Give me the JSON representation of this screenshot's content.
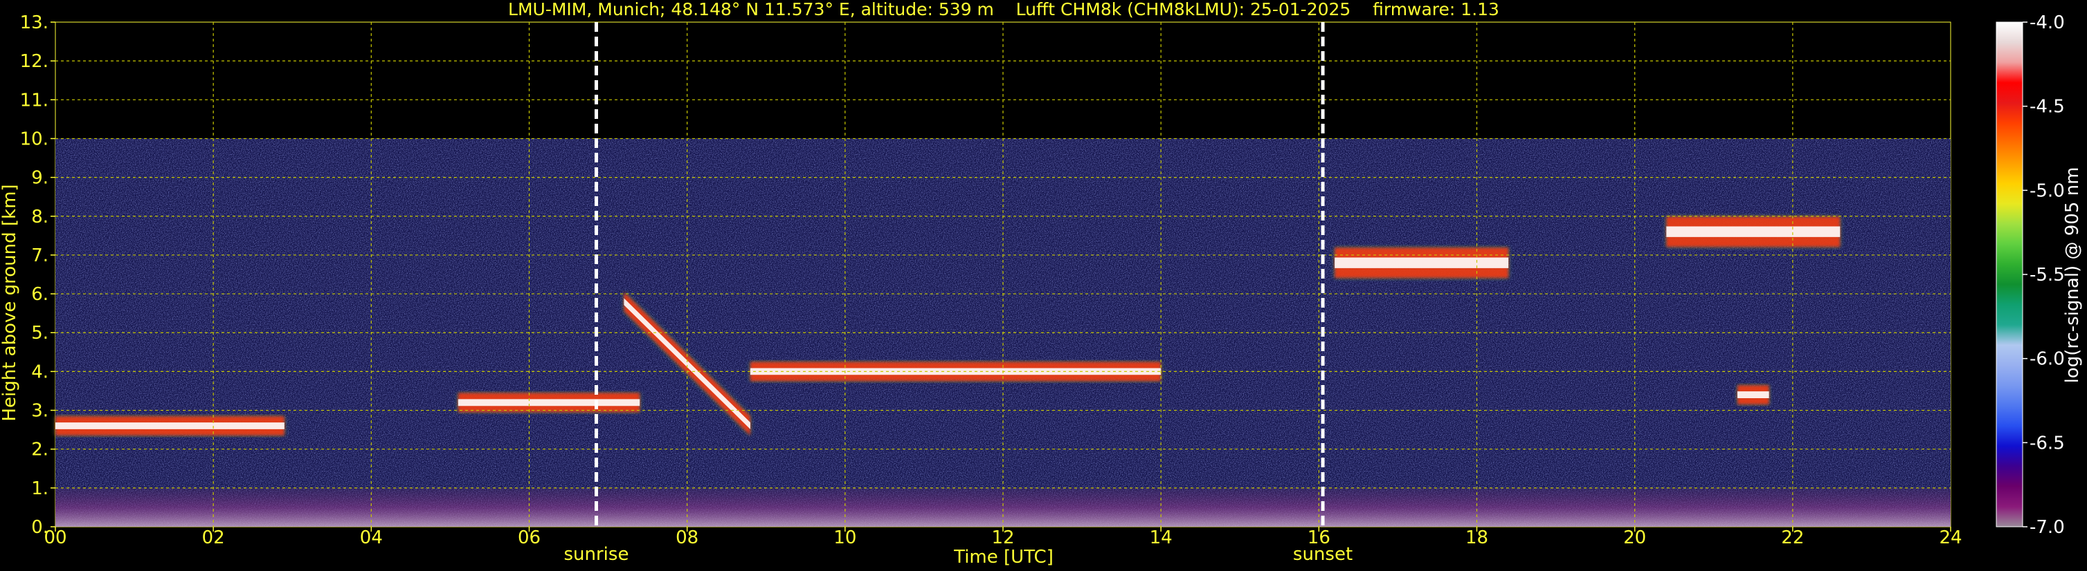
{
  "title": "LMU-MIM, Munich; 48.148° N 11.573° E, altitude: 539 m    Lufft CHM8k (CHM8kLMU): 25-01-2025    firmware: 1.13",
  "colors": {
    "background": "#000000",
    "text": "#ffff33",
    "grid": "#c8c800",
    "colorbar_text": "#ffffff"
  },
  "chart_data": {
    "type": "heatmap",
    "title": "LMU-MIM, Munich; 48.148° N 11.573° E, altitude: 539 m    Lufft CHM8k (CHM8kLMU): 25-01-2025    firmware: 1.13",
    "xlabel": "Time [UTC]",
    "ylabel": "Height above ground [km]",
    "xlim": [
      0,
      24
    ],
    "ylim": [
      0,
      13
    ],
    "x_ticks": [
      "00",
      "02",
      "04",
      "06",
      "08",
      "10",
      "12",
      "14",
      "16",
      "18",
      "20",
      "22",
      "24"
    ],
    "y_ticks": [
      "0.",
      "1.",
      "2.",
      "3.",
      "4.",
      "5.",
      "6.",
      "7.",
      "8.",
      "9.",
      "10.",
      "11.",
      "12.",
      "13."
    ],
    "grid": true,
    "data_top_km": 10.0,
    "markers": [
      {
        "label": "sunrise",
        "time": 6.85
      },
      {
        "label": "sunset",
        "time": 16.05
      }
    ],
    "colorbar": {
      "label": "log(rc-signal) @ 905 nm",
      "ticks": [
        "-4.0",
        "-4.5",
        "-5.0",
        "-5.5",
        "-6.0",
        "-6.5",
        "-7.0"
      ],
      "range": [
        -7.0,
        -4.0
      ],
      "colors": [
        "#9a8a9a",
        "#8a1a7a",
        "#6a006a",
        "#3c0090",
        "#1010d0",
        "#2850f0",
        "#5078f0",
        "#7898f0",
        "#98b0f0",
        "#b0c8f0",
        "#20a890",
        "#10a070",
        "#109030",
        "#30b030",
        "#60d040",
        "#a0e040",
        "#e8e820",
        "#ffd000",
        "#ffa000",
        "#ff7000",
        "#ff4000",
        "#e81818",
        "#ff0000",
        "#f0a0a0",
        "#e8d8d8",
        "#ffffff"
      ]
    },
    "features": [
      {
        "name": "low cloud layer",
        "t_start": 0.0,
        "t_end": 2.9,
        "h_km": 2.6
      },
      {
        "name": "low cloud layer",
        "t_start": 5.1,
        "t_end": 7.4,
        "h_km": 3.2
      },
      {
        "name": "descending cloud layer",
        "t_start": 7.2,
        "t_end": 8.8,
        "h_km_start": 5.8,
        "h_km_end": 2.6
      },
      {
        "name": "cloud layer",
        "t_start": 8.8,
        "t_end": 14.0,
        "h_km": 4.0
      },
      {
        "name": "high cloud",
        "t_start": 16.2,
        "t_end": 18.4,
        "h_km": 6.8
      },
      {
        "name": "high cloud",
        "t_start": 20.4,
        "t_end": 22.6,
        "h_km": 7.6
      },
      {
        "name": "isolated cloud",
        "t_start": 21.3,
        "t_end": 21.7,
        "h_km": 3.4
      },
      {
        "name": "boundary layer aerosol",
        "t_start": 0.0,
        "t_end": 24.0,
        "h_km": 0.5
      }
    ]
  }
}
